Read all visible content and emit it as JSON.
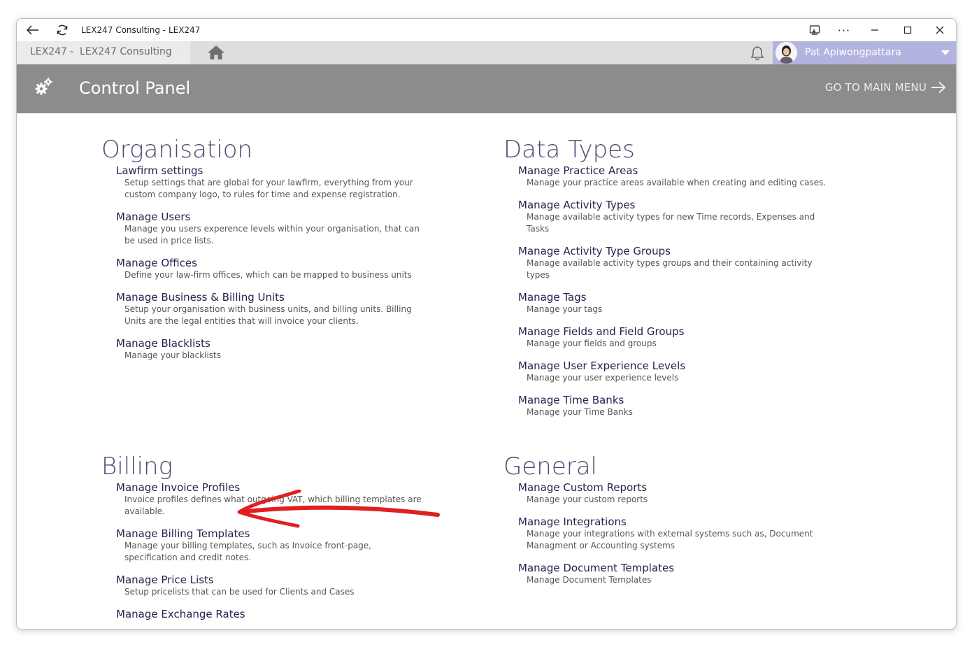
{
  "window": {
    "title": "LEX247 Consulting - LEX247"
  },
  "navbar": {
    "tenant_short": "LEX247",
    "tenant_separator": "-",
    "tenant_name": "LEX247 Consulting",
    "user_name": "Pat Apiwongpattara"
  },
  "header": {
    "title": "Control Panel",
    "main_menu_label": "GO TO MAIN MENU"
  },
  "sections": {
    "organisation": {
      "title": "Organisation",
      "items": [
        {
          "title": "Lawfirm settings",
          "desc": "Setup settings that are global for your lawfirm, everything from your\ncustom company logo, to rules for time and expense registration."
        },
        {
          "title": "Manage Users",
          "desc": "Manage you users experence levels within your organisation, that can\nbe used in price lists."
        },
        {
          "title": "Manage Offices",
          "desc": "Define your law-firm offices, which can be mapped to business units"
        },
        {
          "title": "Manage Business & Billing Units",
          "desc": "Setup your organisation with business units, and billing units. Billing\nUnits are the legal entities that will invoice your clients."
        },
        {
          "title": "Manage Blacklists",
          "desc": "Manage your blacklists"
        }
      ]
    },
    "data_types": {
      "title": "Data Types",
      "items": [
        {
          "title": "Manage Practice Areas",
          "desc": "Manage your practice areas available when creating and editing cases."
        },
        {
          "title": "Manage Activity Types",
          "desc": "Manage available activity types for new Time records, Expenses and\nTasks"
        },
        {
          "title": "Manage Activity Type Groups",
          "desc": "Manage available activity types groups and their containing activity\ntypes"
        },
        {
          "title": "Manage Tags",
          "desc": "Manage your tags"
        },
        {
          "title": "Manage Fields and Field Groups",
          "desc": "Manage your fields and groups"
        },
        {
          "title": "Manage User Experience Levels",
          "desc": "Manage your user experience levels"
        },
        {
          "title": "Manage Time Banks",
          "desc": "Manage your Time Banks"
        }
      ]
    },
    "billing": {
      "title": "Billing",
      "items": [
        {
          "title": "Manage Invoice Profiles",
          "desc": "Invoice profiles defines what outgoing VAT, which billing templates are\navailable."
        },
        {
          "title": "Manage Billing Templates",
          "desc": "Manage your billing templates, such as Invoice front-page,\nspecification and credit notes."
        },
        {
          "title": "Manage Price Lists",
          "desc": "Setup pricelists that can be used for Clients and Cases"
        },
        {
          "title": "Manage Exchange Rates",
          "desc": ""
        }
      ]
    },
    "general": {
      "title": "General",
      "items": [
        {
          "title": "Manage Custom Reports",
          "desc": "Manage your custom reports"
        },
        {
          "title": "Manage Integrations",
          "desc": "Manage your integrations with external systems such as, Document\nManagment or Accounting systems"
        },
        {
          "title": "Manage Document Templates",
          "desc": "Manage Document Templates"
        }
      ]
    }
  },
  "colors": {
    "header_bg": "#8c8c8c",
    "user_bg": "#b3b3e0",
    "section_title": "#4a4a72",
    "link": "#23234f",
    "annotation_arrow": "#e02020"
  }
}
